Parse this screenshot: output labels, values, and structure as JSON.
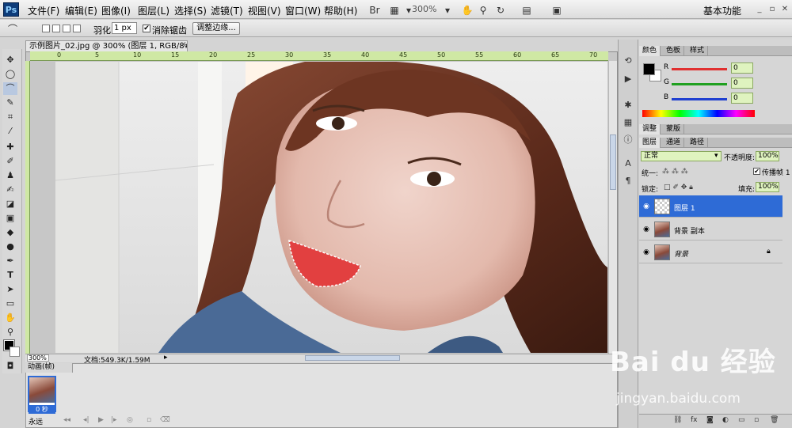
{
  "menubar": {
    "logo": "Ps",
    "items": [
      "文件(F)",
      "编辑(E)",
      "图像(I)",
      "图层(L)",
      "选择(S)",
      "滤镜(T)",
      "视图(V)",
      "窗口(W)",
      "帮助(H)"
    ],
    "zoom": "300%",
    "workspace": "基本功能"
  },
  "options": {
    "feather_label": "羽化:",
    "feather_value": "1 px",
    "antialias_label": "消除锯齿",
    "antialias_checked": "✔",
    "refine_edge": "调整边缘..."
  },
  "document": {
    "tab_title": "示例图片_02.jpg @ 300% (图层 1, RGB/8#) *",
    "ruler_numbers": [
      "0",
      "5",
      "10",
      "15",
      "20",
      "25",
      "30",
      "35",
      "40",
      "45",
      "50",
      "55",
      "60",
      "65",
      "70"
    ],
    "zoom_status": "300%",
    "doc_info": "文档:549.3K/1.59M"
  },
  "animation": {
    "tab": "动画(帧)",
    "frame_number": "1",
    "frame_time": "0 秒",
    "loop": "永远"
  },
  "color_panel": {
    "tabs": [
      "颜色",
      "色板",
      "样式"
    ],
    "channels": [
      {
        "name": "R",
        "value": "0",
        "color": "#e03030"
      },
      {
        "name": "G",
        "value": "0",
        "color": "#20a020"
      },
      {
        "name": "B",
        "value": "0",
        "color": "#2040d0"
      }
    ]
  },
  "adjust_panel": {
    "tabs": [
      "调整",
      "蒙版"
    ]
  },
  "layers_panel": {
    "tabs": [
      "图层",
      "通道",
      "路径"
    ],
    "blend_mode": "正常",
    "opacity_label": "不透明度:",
    "opacity": "100%",
    "unify_label": "统一:",
    "propagate_label": "传播帧 1",
    "lock_label": "锁定:",
    "fill_label": "填充:",
    "fill": "100%",
    "layers": [
      {
        "name": "图层 1",
        "selected": true
      },
      {
        "name": "背景 副本",
        "selected": false
      },
      {
        "name": "背景",
        "selected": false
      }
    ]
  },
  "watermark": {
    "logo": "Bai du 经验",
    "url": "jingyan.baidu.com"
  }
}
